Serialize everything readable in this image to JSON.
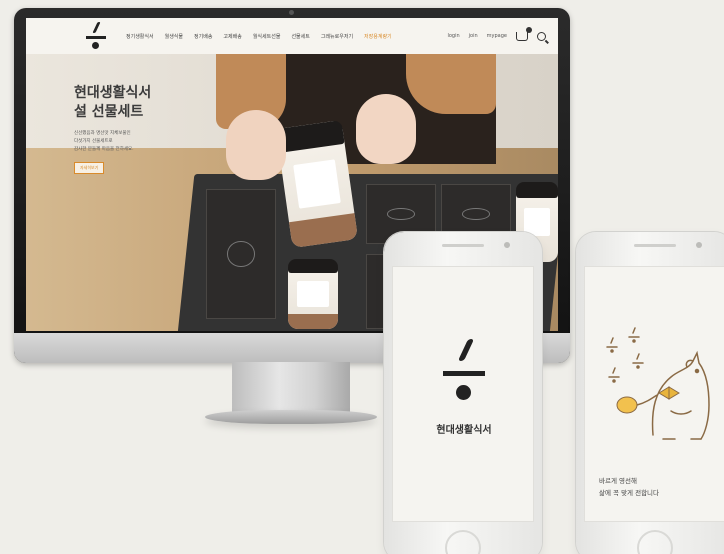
{
  "desktop_site": {
    "nav": {
      "menu": [
        "정기생활식서",
        "월생식물",
        "정기배송",
        "고제배송",
        "월식세트선물",
        "선물세트",
        "그레뉴로우저기",
        "저장용계량기"
      ],
      "active_index": 7,
      "login": "login",
      "join": "join",
      "mypage": "mypage",
      "cart_icon": "cart-icon",
      "search_icon": "search-icon"
    },
    "hero": {
      "title": "현대생활식서\n설 선물세트",
      "subtitle": "신선했음과 명선맛 지체보물인\n다섯가지 선물세트로\n감사한 분들께 마음을 전하세요.",
      "button_label": "자세히보기"
    }
  },
  "phone_left": {
    "brand_name": "현대생활식서"
  },
  "phone_right": {
    "message": "바르게 영선해\n삶에 꼭 맞게 전합니다"
  },
  "colors": {
    "accent": "#d98b2b",
    "dark": "#222222",
    "background": "#efeee9"
  }
}
